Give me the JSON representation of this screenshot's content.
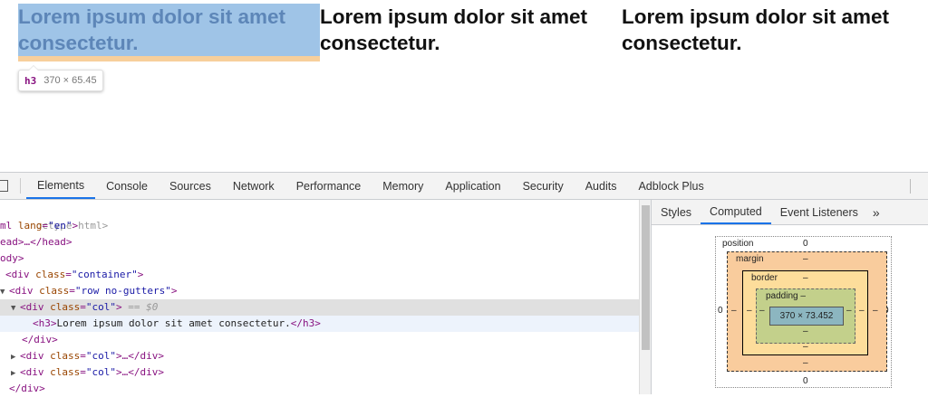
{
  "preview": {
    "columns": [
      {
        "text": "Lorem ipsum dolor sit amet consectetur."
      },
      {
        "text": "Lorem ipsum dolor sit amet consectetur."
      },
      {
        "text": "Lorem ipsum dolor sit amet consectetur."
      }
    ],
    "tooltip": {
      "tag": "h3",
      "size": "370 × 65.45"
    }
  },
  "devtools": {
    "tabs": [
      "Elements",
      "Console",
      "Sources",
      "Network",
      "Performance",
      "Memory",
      "Application",
      "Security",
      "Audits",
      "Adblock Plus"
    ],
    "active_tab": "Elements",
    "tree": [
      {
        "text": "octype html>"
      },
      {
        "open": "ml",
        "attr": "lang",
        "value": "\"en\"",
        "close": ">"
      },
      {
        "text": "ead>…</head>"
      },
      {
        "text": "ody>"
      },
      {
        "open": "<div",
        "attr": "class",
        "value": "\"container\"",
        "close": ">"
      },
      {
        "open": "<div",
        "attr": "class",
        "value": "\"row no-gutters\"",
        "close": ">"
      },
      {
        "open": "<div",
        "attr": "class",
        "value": "\"col\"",
        "close": ">",
        "extra": " == $0"
      },
      {
        "open": "<h3>",
        "text": "Lorem ipsum dolor sit amet consectetur.",
        "close": "</h3>"
      },
      {
        "text": "</div>"
      },
      {
        "open": "<div",
        "attr": "class",
        "value": "\"col\"",
        "close": ">…</div>"
      },
      {
        "open": "<div",
        "attr": "class",
        "value": "\"col\"",
        "close": ">…</div>"
      },
      {
        "text": "</div>"
      }
    ],
    "side_tabs": [
      "Styles",
      "Computed",
      "Event Listeners"
    ],
    "side_more": "»",
    "box_model": {
      "position_label": "position",
      "position_top": "0",
      "position_bottom": "0",
      "position_left": "0",
      "position_right": "0",
      "margin_label": "margin",
      "margin_top": "–",
      "margin_bottom": "–",
      "margin_left": "–",
      "margin_right": "–",
      "border_label": "border",
      "border_top": "–",
      "border_bottom": "–",
      "border_left": "–",
      "border_right": "–",
      "padding_label": "padding –",
      "padding_bottom": "–",
      "padding_left": "–",
      "padding_right": "–",
      "content": "370 × 73.452"
    }
  }
}
